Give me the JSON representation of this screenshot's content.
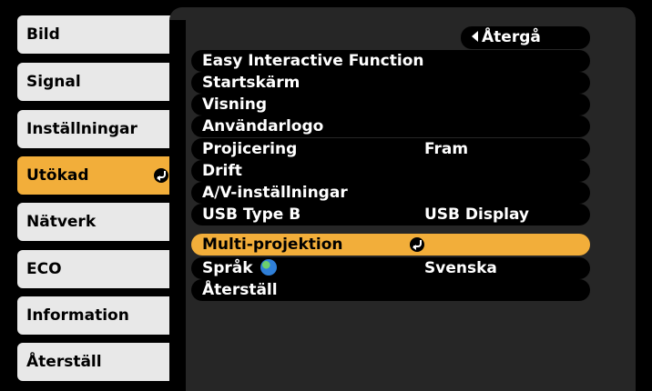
{
  "tabs": [
    {
      "label": "Bild"
    },
    {
      "label": "Signal"
    },
    {
      "label": "Inställningar"
    },
    {
      "label": "Utökad"
    },
    {
      "label": "Nätverk"
    },
    {
      "label": "ECO"
    },
    {
      "label": "Information"
    },
    {
      "label": "Återställ"
    }
  ],
  "back_label": "Återgå",
  "menu": [
    {
      "label": "Easy Interactive Function",
      "value": ""
    },
    {
      "label": "Startskärm",
      "value": ""
    },
    {
      "label": "Visning",
      "value": ""
    },
    {
      "label": "Användarlogo",
      "value": ""
    },
    {
      "label": "Projicering",
      "value": "Fram"
    },
    {
      "label": "Drift",
      "value": ""
    },
    {
      "label": "A/V-inställningar",
      "value": ""
    },
    {
      "label": "USB Type B",
      "value": "USB Display"
    },
    {
      "label": "Multi-projektion",
      "value": ""
    },
    {
      "label": "Språk",
      "value": "Svenska"
    },
    {
      "label": "Återställ",
      "value": ""
    }
  ],
  "colors": {
    "accent": "#f2ae3a",
    "tab": "#e8e8e8",
    "panel": "#262626"
  },
  "icons": {
    "enter": "enter-icon",
    "globe": "globe-icon",
    "back": "back-arrow-icon"
  }
}
